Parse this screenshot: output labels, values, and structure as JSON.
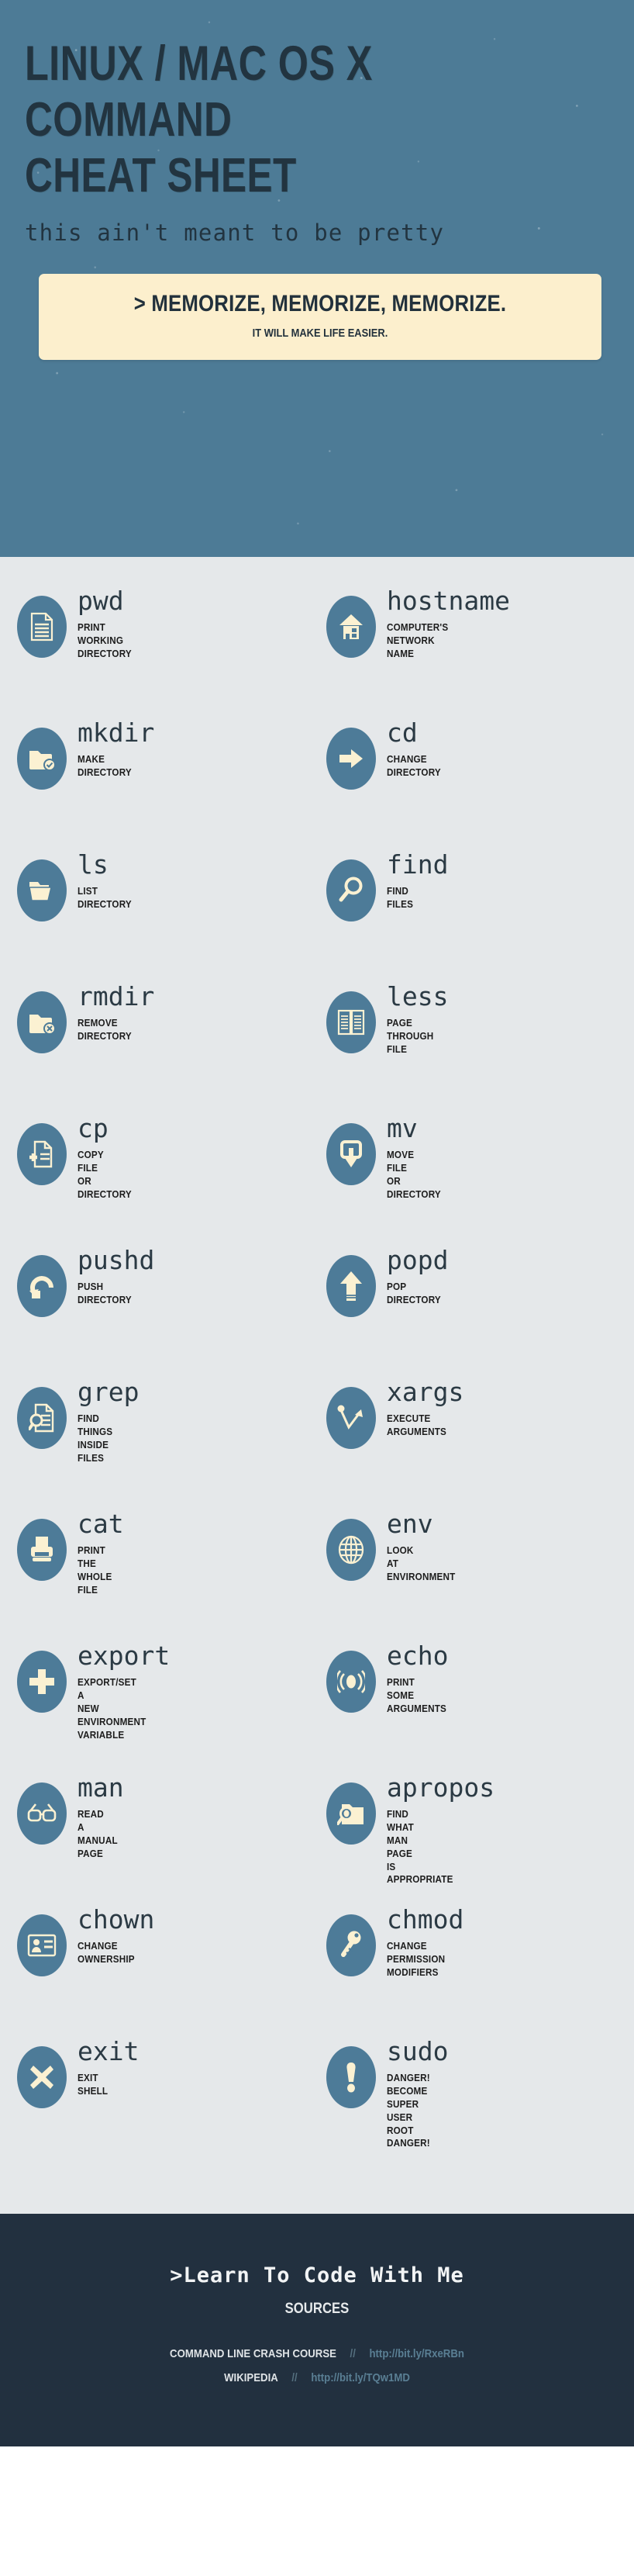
{
  "header": {
    "title_lines": [
      "LINUX / MAC OS X",
      "COMMAND",
      "CHEAT SHEET"
    ],
    "subtitle": "this ain't meant to be pretty",
    "callout": {
      "main": "> MEMORIZE, MEMORIZE, MEMORIZE.",
      "sub": "IT WILL MAKE LIFE EASIER."
    },
    "colors": {
      "background": "#4d7b96",
      "title": "#223440",
      "callout_bg": "#fcefcd"
    }
  },
  "body": {
    "background": "#e5e8ea",
    "icon_color": "#4d7b98",
    "glyph_color": "#fbf1d2",
    "commands": [
      {
        "name": "pwd",
        "icon": "document-icon",
        "desc": [
          "PRINT",
          "WORKING",
          "DIRECTORY"
        ]
      },
      {
        "name": "hostname",
        "icon": "house-icon",
        "desc": [
          "COMPUTER'S",
          "NETWORK",
          "NAME"
        ]
      },
      {
        "name": "mkdir",
        "icon": "folder-check-icon",
        "desc": [
          "MAKE",
          "DIRECTORY"
        ]
      },
      {
        "name": "cd",
        "icon": "arrow-right-icon",
        "desc": [
          "CHANGE",
          "DIRECTORY"
        ]
      },
      {
        "name": "ls",
        "icon": "folder-open-icon",
        "desc": [
          "LIST",
          "DIRECTORY"
        ]
      },
      {
        "name": "find",
        "icon": "magnifier-icon",
        "desc": [
          "FIND",
          "FILES"
        ]
      },
      {
        "name": "rmdir",
        "icon": "folder-x-icon",
        "desc": [
          "REMOVE",
          "DIRECTORY"
        ]
      },
      {
        "name": "less",
        "icon": "open-book-icon",
        "desc": [
          "PAGE",
          "THROUGH",
          "FILE"
        ]
      },
      {
        "name": "cp",
        "icon": "document-plus-icon",
        "desc": [
          "COPY",
          "FILE",
          "OR",
          "DIRECTORY"
        ]
      },
      {
        "name": "mv",
        "icon": "arrow-down-box-icon",
        "desc": [
          "MOVE",
          "FILE",
          "OR",
          "DIRECTORY"
        ]
      },
      {
        "name": "pushd",
        "icon": "curved-arrow-icon",
        "desc": [
          "PUSH",
          "DIRECTORY"
        ]
      },
      {
        "name": "popd",
        "icon": "arrow-up-icon",
        "desc": [
          "POP",
          "DIRECTORY"
        ]
      },
      {
        "name": "grep",
        "icon": "document-search-icon",
        "desc": [
          "FIND",
          "THINGS",
          "INSIDE",
          "FILES"
        ]
      },
      {
        "name": "xargs",
        "icon": "zigzag-arrow-icon",
        "desc": [
          "EXECUTE",
          "ARGUMENTS"
        ]
      },
      {
        "name": "cat",
        "icon": "printer-icon",
        "desc": [
          "PRINT",
          "THE",
          "WHOLE",
          "FILE"
        ]
      },
      {
        "name": "env",
        "icon": "globe-icon",
        "desc": [
          "LOOK",
          "AT",
          "ENVIRONMENT"
        ]
      },
      {
        "name": "export",
        "icon": "plus-icon",
        "desc": [
          "EXPORT/SET",
          "A",
          "NEW",
          "ENVIRONMENT",
          "VARIABLE"
        ]
      },
      {
        "name": "echo",
        "icon": "broadcast-icon",
        "desc": [
          "PRINT",
          "SOME",
          "ARGUMENTS"
        ]
      },
      {
        "name": "man",
        "icon": "glasses-icon",
        "desc": [
          "READ",
          "A",
          "MANUAL",
          "PAGE"
        ]
      },
      {
        "name": "apropos",
        "icon": "folder-search-icon",
        "desc": [
          "FIND",
          "WHAT",
          "MAN",
          "PAGE",
          "IS",
          "APPROPRIATE"
        ]
      },
      {
        "name": "chown",
        "icon": "id-card-icon",
        "desc": [
          "CHANGE",
          "OWNERSHIP"
        ]
      },
      {
        "name": "chmod",
        "icon": "key-icon",
        "desc": [
          "CHANGE",
          "PERMISSION",
          "MODIFIERS"
        ]
      },
      {
        "name": "exit",
        "icon": "x-mark-icon",
        "desc": [
          "EXIT",
          "SHELL"
        ]
      },
      {
        "name": "sudo",
        "icon": "exclamation-icon",
        "desc": [
          "DANGER!",
          "BECOME",
          "SUPER",
          "USER",
          "ROOT",
          "DANGER!"
        ]
      }
    ]
  },
  "footer": {
    "brand": ">Learn To Code With Me",
    "sources_label": "SOURCES",
    "separator": "//",
    "sources": [
      {
        "name": "COMMAND LINE CRASH COURSE",
        "url": "http://bit.ly/RxeRBn"
      },
      {
        "name": "WIKIPEDIA",
        "url": "http://bit.ly/TQw1MD"
      }
    ],
    "colors": {
      "background": "#22303f",
      "url": "#5a7f94"
    }
  }
}
